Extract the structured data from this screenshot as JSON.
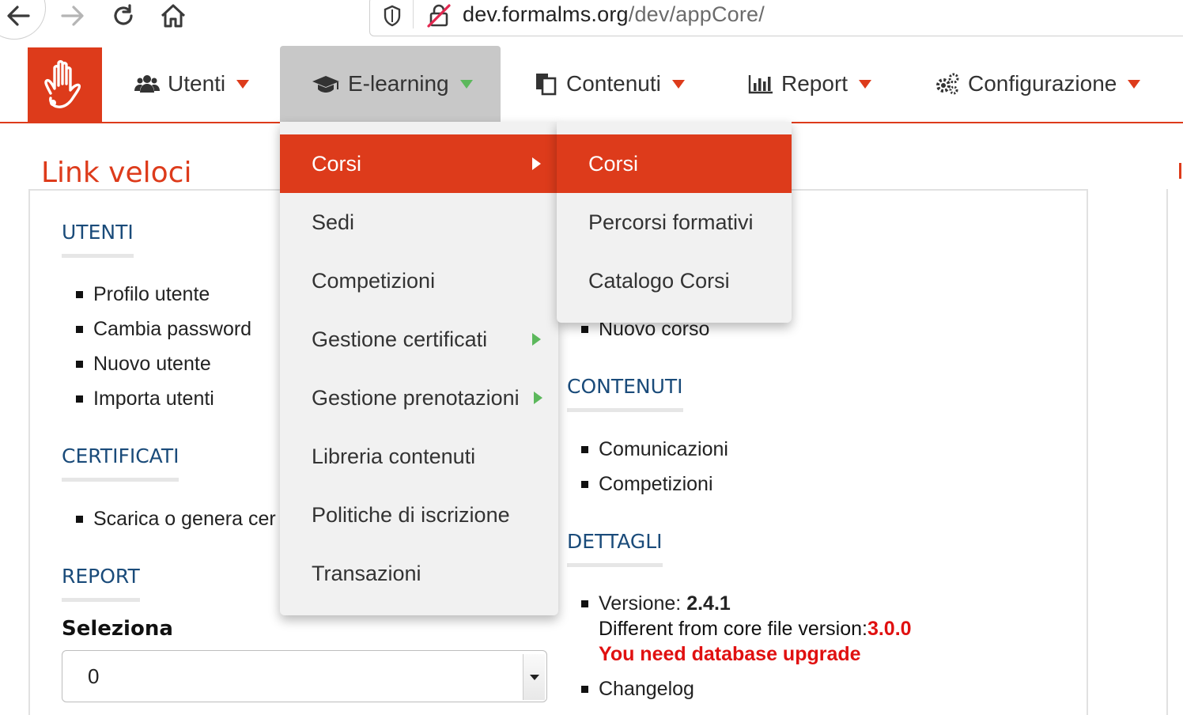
{
  "browser": {
    "url_host": "dev.formalms.org",
    "url_path": "/dev/appCore/"
  },
  "nav": {
    "items": [
      {
        "label": "Utenti",
        "icon": "users-icon"
      },
      {
        "label": "E-learning",
        "icon": "graduation-cap-icon"
      },
      {
        "label": "Contenuti",
        "icon": "copy-icon"
      },
      {
        "label": "Report",
        "icon": "bar-chart-icon"
      },
      {
        "label": "Configurazione",
        "icon": "gears-icon"
      }
    ],
    "active_index": 1
  },
  "page": {
    "title": "Link veloci"
  },
  "sections": {
    "utenti": {
      "heading": "UTENTI",
      "items": [
        "Profilo utente",
        "Cambia password",
        "Nuovo utente",
        "Importa utenti"
      ]
    },
    "certificati": {
      "heading": "CERTIFICATI",
      "items": [
        "Scarica o genera cer"
      ]
    },
    "report": {
      "heading": "REPORT",
      "select_label": "Seleziona",
      "select_value": "0"
    },
    "corsi_partial": {
      "items": [
        "Nuovo corso"
      ]
    },
    "contenuti": {
      "heading": "CONTENUTI",
      "items": [
        "Comunicazioni",
        "Competizioni"
      ]
    },
    "dettagli": {
      "heading": "DETTAGLI",
      "version_label": "Versione: ",
      "version_value": "2.4.1",
      "core_diff_label": "Different from core file version:",
      "core_version": "3.0.0",
      "upgrade_warning": "You need database upgrade",
      "changelog": "Changelog"
    }
  },
  "dropdown": {
    "items": [
      {
        "label": "Corsi",
        "has_sub": true,
        "active": true
      },
      {
        "label": "Sedi",
        "has_sub": false
      },
      {
        "label": "Competizioni",
        "has_sub": false
      },
      {
        "label": "Gestione certificati",
        "has_sub": true
      },
      {
        "label": "Gestione prenotazioni",
        "has_sub": true
      },
      {
        "label": "Libreria contenuti",
        "has_sub": false
      },
      {
        "label": "Politiche di iscrizione",
        "has_sub": false
      },
      {
        "label": "Transazioni",
        "has_sub": false
      }
    ]
  },
  "submenu": {
    "items": [
      {
        "label": "Corsi",
        "active": true
      },
      {
        "label": "Percorsi formativi"
      },
      {
        "label": "Catalogo Corsi"
      }
    ]
  },
  "colors": {
    "brand": "#dd3b1b",
    "heading_blue": "#1a4b7a",
    "accent_green": "#5cb85c",
    "warning_red": "#e01010"
  }
}
